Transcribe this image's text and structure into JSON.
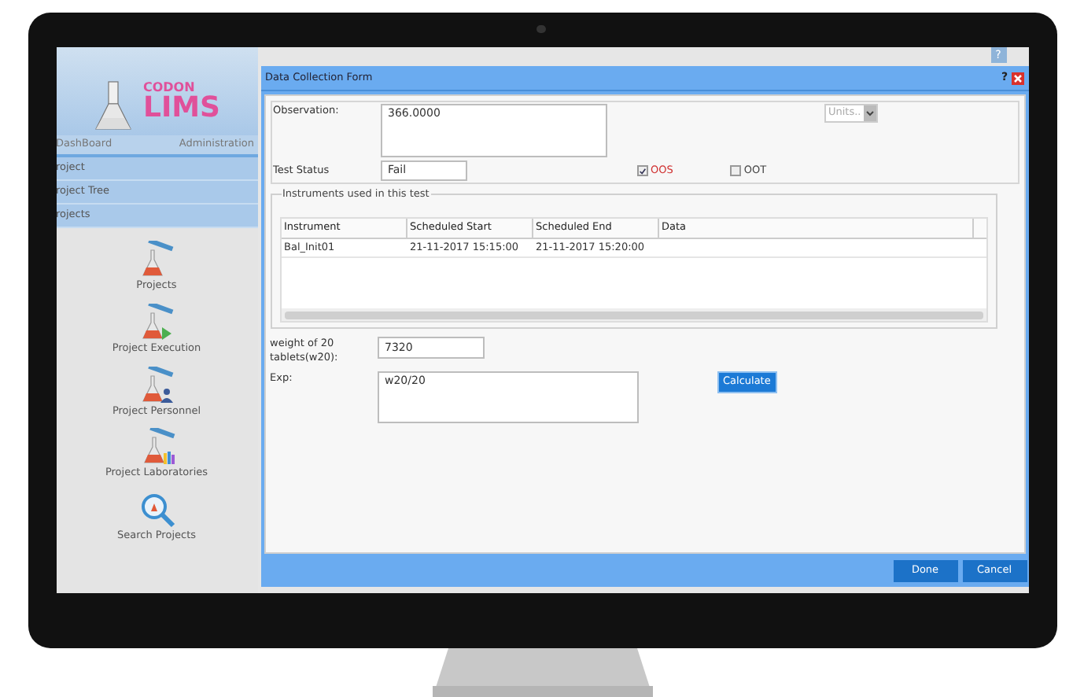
{
  "app": {
    "logo": {
      "line1": "CODON",
      "line2": "LIMS"
    },
    "nav_tabs": [
      {
        "label": "DashBoard",
        "selected": false
      },
      {
        "label": "Administration",
        "selected": false
      }
    ],
    "sidebar": {
      "items": [
        {
          "label": "roject"
        },
        {
          "label": "roject Tree"
        },
        {
          "label": "rojects"
        }
      ]
    },
    "launch_items": [
      {
        "label": "Projects",
        "kind": "flask"
      },
      {
        "label": "Project Execution",
        "kind": "flask-play"
      },
      {
        "label": "Project Personnel",
        "kind": "flask-people"
      },
      {
        "label": "Project Laboratories",
        "kind": "flask-books"
      },
      {
        "label": "Search Projects",
        "kind": "search"
      }
    ],
    "help_button": "?"
  },
  "dialog": {
    "title": "Data Collection Form",
    "help": "?",
    "observation": {
      "label": "Observation:",
      "value": "366.0000"
    },
    "units": {
      "placeholder": "Units.."
    },
    "test_status": {
      "label": "Test Status",
      "value": "Fail"
    },
    "flags": [
      {
        "label": "OOS",
        "checked": true
      },
      {
        "label": "OOT",
        "checked": false
      }
    ],
    "instruments": {
      "title": "Instruments used in this test",
      "columns": [
        "Instrument",
        "Scheduled Start",
        "Scheduled End",
        "Data"
      ],
      "rows": [
        [
          "Bal_Init01",
          "21-11-2017 15:15:00",
          "21-11-2017 15:20:00",
          ""
        ]
      ]
    },
    "weight": {
      "label": "weight of 20 tablets(w20):",
      "value": "7320"
    },
    "exp": {
      "label": "Exp:",
      "value": "w20/20"
    },
    "calculate": "Calculate",
    "buttons": [
      "Done",
      "Cancel"
    ]
  }
}
